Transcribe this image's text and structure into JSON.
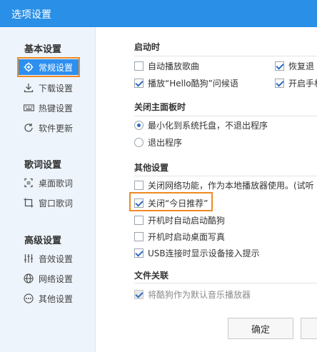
{
  "window": {
    "title": "选项设置"
  },
  "sidebar": {
    "sections": [
      {
        "title": "基本设置",
        "items": [
          {
            "label": "常规设置",
            "icon": "gear-icon",
            "active": true
          },
          {
            "label": "下载设置",
            "icon": "download-icon"
          },
          {
            "label": "热键设置",
            "icon": "keyboard-icon"
          },
          {
            "label": "软件更新",
            "icon": "refresh-icon"
          }
        ]
      },
      {
        "title": "歌词设置",
        "items": [
          {
            "label": "桌面歌词",
            "icon": "desktop-lyrics-icon"
          },
          {
            "label": "窗口歌词",
            "icon": "window-lyrics-icon"
          }
        ]
      },
      {
        "title": "高级设置",
        "items": [
          {
            "label": "音效设置",
            "icon": "equalizer-icon"
          },
          {
            "label": "网络设置",
            "icon": "globe-icon"
          },
          {
            "label": "其他设置",
            "icon": "more-icon"
          }
        ]
      }
    ]
  },
  "startup": {
    "title": "启动时",
    "auto_play": {
      "label": "自动播放歌曲",
      "checked": false
    },
    "restore": {
      "label": "恢复退",
      "checked": true
    },
    "greeting": {
      "label": "播放“Hello酷狗”问候语",
      "checked": true
    },
    "open_mid": {
      "label": "开启手机",
      "checked": true
    }
  },
  "close_panel": {
    "title": "关闭主面板时",
    "minimize": {
      "label": "最小化到系统托盘，不退出程序",
      "selected": true
    },
    "exit": {
      "label": "退出程序",
      "selected": false
    }
  },
  "other": {
    "title": "其他设置",
    "disable_network": {
      "label": "关闭网络功能，作为本地播放器使用。(试听",
      "checked": false
    },
    "close_today": {
      "label": "关闭“今日推荐”",
      "checked": true
    },
    "autostart": {
      "label": "开机时自动启动酷狗",
      "checked": false
    },
    "autostart_desktop": {
      "label": "开机时启动桌面写真",
      "checked": false
    },
    "usb_prompt": {
      "label": "USB连接时显示设备接入提示",
      "checked": true
    }
  },
  "file_assoc": {
    "title": "文件关联",
    "default_player": {
      "label": "将酷狗作为默认音乐播放器",
      "checked": true,
      "disabled": true
    }
  },
  "buttons": {
    "ok": "确定"
  },
  "colors": {
    "titlebar": "#2a8fe6",
    "active_item": "#2d8ff0",
    "highlight": "#f08a24"
  }
}
